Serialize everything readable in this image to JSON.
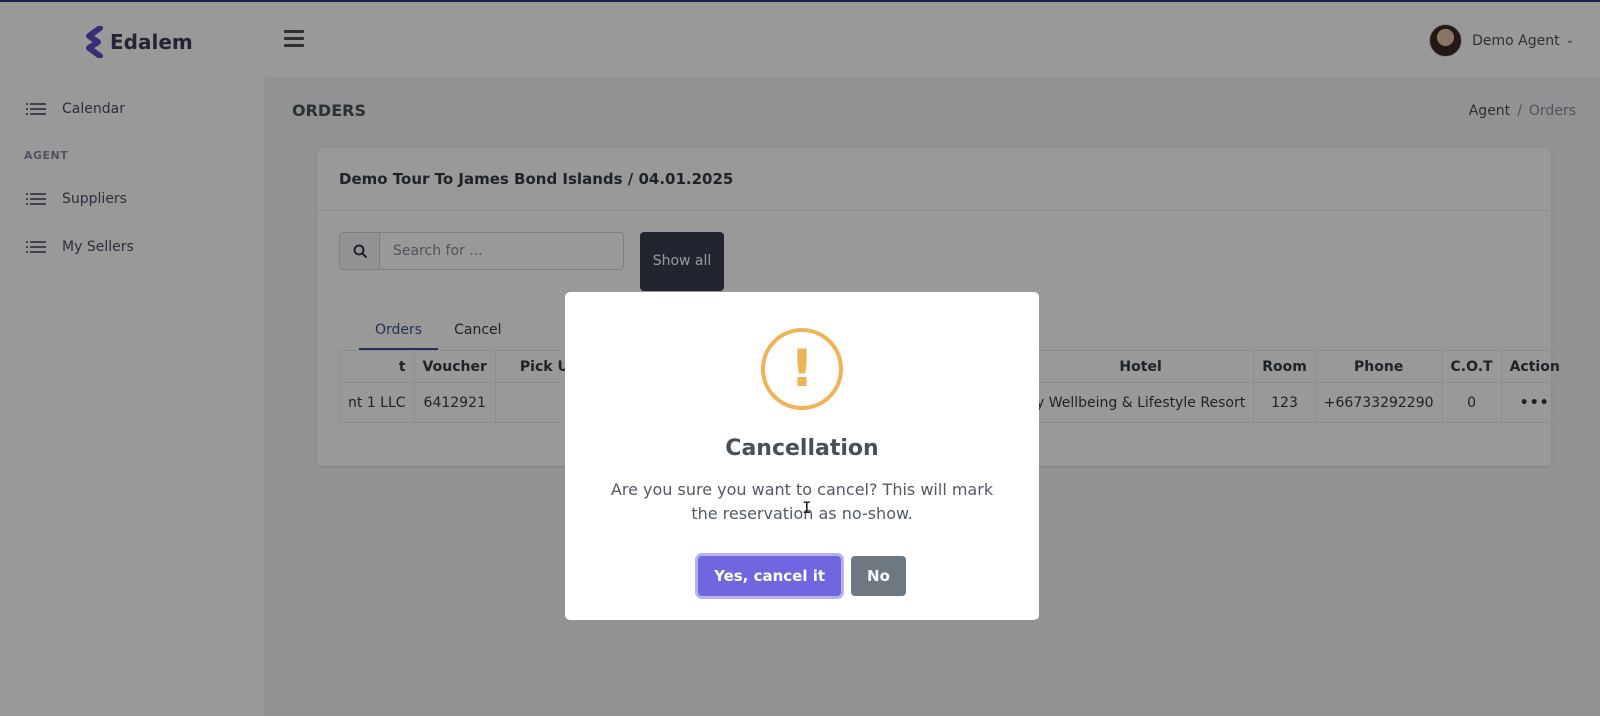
{
  "app": {
    "brand": "Edalem"
  },
  "user": {
    "name": "Demo Agent"
  },
  "sidebar": {
    "items": [
      {
        "label": "Calendar"
      },
      {
        "label": "Suppliers"
      },
      {
        "label": "My Sellers"
      }
    ],
    "section_label": "AGENT"
  },
  "page": {
    "title": "ORDERS",
    "breadcrumb": [
      "Agent",
      "/",
      "Orders"
    ]
  },
  "card": {
    "title": "Demo Tour To James Bond Islands / 04.01.2025",
    "search_placeholder": "Search for ...",
    "show_all_label": "Show all"
  },
  "tabs": [
    {
      "label": "Orders",
      "active": true
    },
    {
      "label": "Cancel",
      "active": false
    }
  ],
  "table": {
    "left_headers": [
      "t",
      "Voucher",
      "Pick Up"
    ],
    "left_row": [
      "nt 1 LLC",
      "6412921",
      ""
    ],
    "right_headers": [
      "Hotel",
      "Room",
      "Phone",
      "C.O.T",
      "Action"
    ],
    "right_row": [
      "y Wellbeing & Lifestyle Resort",
      "123",
      "+66733292290",
      "0",
      "•••"
    ]
  },
  "modal": {
    "title": "Cancellation",
    "text": "Are you sure you want to cancel? This will mark the reservation as no-show.",
    "confirm_label": "Yes, cancel it",
    "cancel_label": "No",
    "icon_glyph": "!"
  },
  "colors": {
    "brand": "#405189",
    "warning": "#f0b355",
    "confirm": "#7066e0",
    "cancel": "#6e7881"
  }
}
